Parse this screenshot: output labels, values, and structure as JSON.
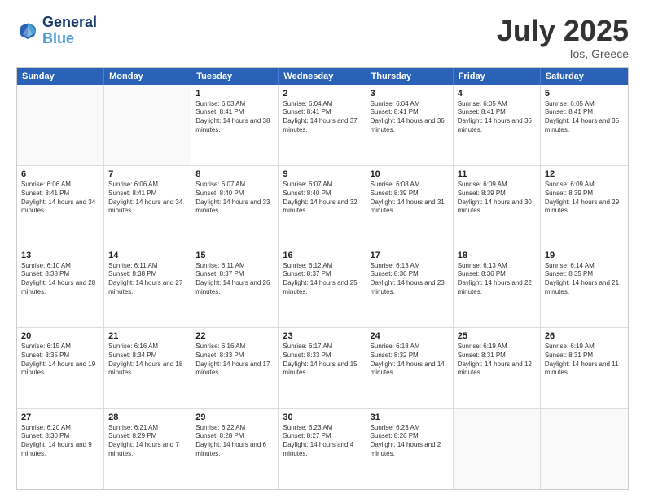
{
  "logo": {
    "text1": "General",
    "text2": "Blue"
  },
  "title": "July 2025",
  "location": "Ios, Greece",
  "header_days": [
    "Sunday",
    "Monday",
    "Tuesday",
    "Wednesday",
    "Thursday",
    "Friday",
    "Saturday"
  ],
  "weeks": [
    [
      {
        "day": "",
        "info": ""
      },
      {
        "day": "",
        "info": ""
      },
      {
        "day": "1",
        "info": "Sunrise: 6:03 AM\nSunset: 8:41 PM\nDaylight: 14 hours and 38 minutes."
      },
      {
        "day": "2",
        "info": "Sunrise: 6:04 AM\nSunset: 8:41 PM\nDaylight: 14 hours and 37 minutes."
      },
      {
        "day": "3",
        "info": "Sunrise: 6:04 AM\nSunset: 8:41 PM\nDaylight: 14 hours and 36 minutes."
      },
      {
        "day": "4",
        "info": "Sunrise: 6:05 AM\nSunset: 8:41 PM\nDaylight: 14 hours and 36 minutes."
      },
      {
        "day": "5",
        "info": "Sunrise: 6:05 AM\nSunset: 8:41 PM\nDaylight: 14 hours and 35 minutes."
      }
    ],
    [
      {
        "day": "6",
        "info": "Sunrise: 6:06 AM\nSunset: 8:41 PM\nDaylight: 14 hours and 34 minutes."
      },
      {
        "day": "7",
        "info": "Sunrise: 6:06 AM\nSunset: 8:41 PM\nDaylight: 14 hours and 34 minutes."
      },
      {
        "day": "8",
        "info": "Sunrise: 6:07 AM\nSunset: 8:40 PM\nDaylight: 14 hours and 33 minutes."
      },
      {
        "day": "9",
        "info": "Sunrise: 6:07 AM\nSunset: 8:40 PM\nDaylight: 14 hours and 32 minutes."
      },
      {
        "day": "10",
        "info": "Sunrise: 6:08 AM\nSunset: 8:39 PM\nDaylight: 14 hours and 31 minutes."
      },
      {
        "day": "11",
        "info": "Sunrise: 6:09 AM\nSunset: 8:39 PM\nDaylight: 14 hours and 30 minutes."
      },
      {
        "day": "12",
        "info": "Sunrise: 6:09 AM\nSunset: 8:39 PM\nDaylight: 14 hours and 29 minutes."
      }
    ],
    [
      {
        "day": "13",
        "info": "Sunrise: 6:10 AM\nSunset: 8:38 PM\nDaylight: 14 hours and 28 minutes."
      },
      {
        "day": "14",
        "info": "Sunrise: 6:11 AM\nSunset: 8:38 PM\nDaylight: 14 hours and 27 minutes."
      },
      {
        "day": "15",
        "info": "Sunrise: 6:11 AM\nSunset: 8:37 PM\nDaylight: 14 hours and 26 minutes."
      },
      {
        "day": "16",
        "info": "Sunrise: 6:12 AM\nSunset: 8:37 PM\nDaylight: 14 hours and 25 minutes."
      },
      {
        "day": "17",
        "info": "Sunrise: 6:13 AM\nSunset: 8:36 PM\nDaylight: 14 hours and 23 minutes."
      },
      {
        "day": "18",
        "info": "Sunrise: 6:13 AM\nSunset: 8:36 PM\nDaylight: 14 hours and 22 minutes."
      },
      {
        "day": "19",
        "info": "Sunrise: 6:14 AM\nSunset: 8:35 PM\nDaylight: 14 hours and 21 minutes."
      }
    ],
    [
      {
        "day": "20",
        "info": "Sunrise: 6:15 AM\nSunset: 8:35 PM\nDaylight: 14 hours and 19 minutes."
      },
      {
        "day": "21",
        "info": "Sunrise: 6:16 AM\nSunset: 8:34 PM\nDaylight: 14 hours and 18 minutes."
      },
      {
        "day": "22",
        "info": "Sunrise: 6:16 AM\nSunset: 8:33 PM\nDaylight: 14 hours and 17 minutes."
      },
      {
        "day": "23",
        "info": "Sunrise: 6:17 AM\nSunset: 8:33 PM\nDaylight: 14 hours and 15 minutes."
      },
      {
        "day": "24",
        "info": "Sunrise: 6:18 AM\nSunset: 8:32 PM\nDaylight: 14 hours and 14 minutes."
      },
      {
        "day": "25",
        "info": "Sunrise: 6:19 AM\nSunset: 8:31 PM\nDaylight: 14 hours and 12 minutes."
      },
      {
        "day": "26",
        "info": "Sunrise: 6:19 AM\nSunset: 8:31 PM\nDaylight: 14 hours and 11 minutes."
      }
    ],
    [
      {
        "day": "27",
        "info": "Sunrise: 6:20 AM\nSunset: 8:30 PM\nDaylight: 14 hours and 9 minutes."
      },
      {
        "day": "28",
        "info": "Sunrise: 6:21 AM\nSunset: 8:29 PM\nDaylight: 14 hours and 7 minutes."
      },
      {
        "day": "29",
        "info": "Sunrise: 6:22 AM\nSunset: 8:28 PM\nDaylight: 14 hours and 6 minutes."
      },
      {
        "day": "30",
        "info": "Sunrise: 6:23 AM\nSunset: 8:27 PM\nDaylight: 14 hours and 4 minutes."
      },
      {
        "day": "31",
        "info": "Sunrise: 6:23 AM\nSunset: 8:26 PM\nDaylight: 14 hours and 2 minutes."
      },
      {
        "day": "",
        "info": ""
      },
      {
        "day": "",
        "info": ""
      }
    ]
  ]
}
